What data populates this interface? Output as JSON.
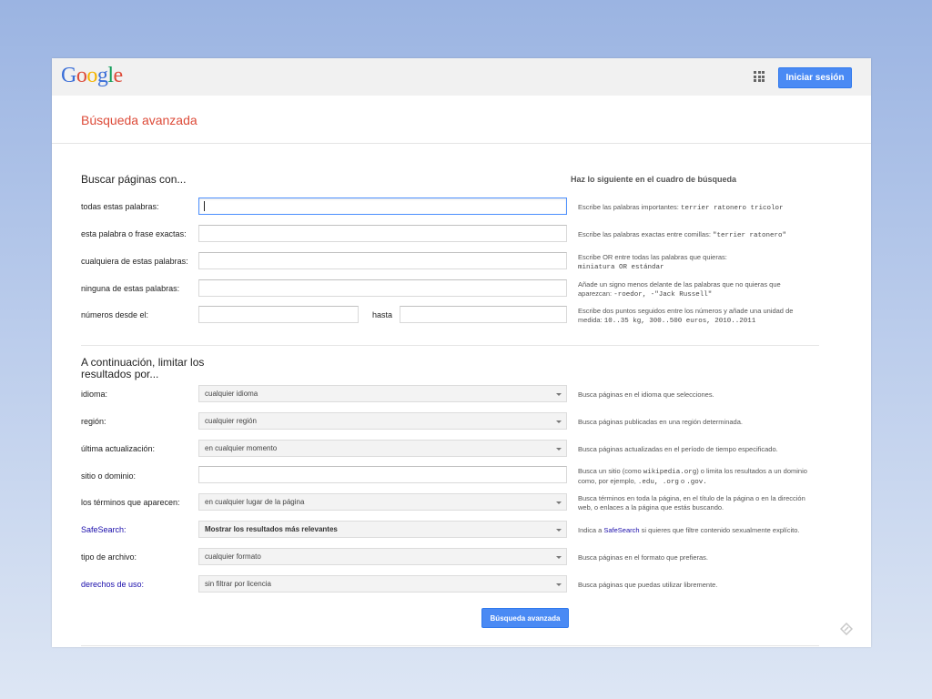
{
  "header": {
    "logo": {
      "letters": [
        "G",
        "o",
        "o",
        "g",
        "l",
        "e"
      ],
      "colors": [
        "#3b6fd8",
        "#dd4b39",
        "#f4b400",
        "#3b6fd8",
        "#0f9d58",
        "#dd4b39"
      ]
    },
    "apps_icon": "apps-grid-icon",
    "signin_label": "Iniciar sesión"
  },
  "page_title": "Búsqueda avanzada",
  "section1": {
    "title": "Buscar páginas con...",
    "hint_title": "Haz lo siguiente en el cuadro de búsqueda",
    "rows": [
      {
        "label": "todas estas palabras:",
        "value": "",
        "hint_text": "Escribe las palabras importantes: ",
        "hint_mono": "terrier ratonero tricolor"
      },
      {
        "label": "esta palabra o frase exactas:",
        "value": "",
        "hint_text": "Escribe las palabras exactas entre comillas: ",
        "hint_mono": "\"terrier ratonero\""
      },
      {
        "label": "cualquiera de estas palabras:",
        "value": "",
        "hint_text": "Escribe OR entre todas las palabras que quieras:",
        "hint_mono": "miniatura OR estándar"
      },
      {
        "label": "ninguna de estas palabras:",
        "value": "",
        "hint_text": "Añade un signo menos delante de las palabras que no quieras que aparezcan: ",
        "hint_mono": "-roedor, -\"Jack Russell\""
      },
      {
        "label": "números desde el:",
        "value": "",
        "hasta_label": "hasta",
        "hasta_value": "",
        "hint_text": "Escribe dos puntos seguidos entre los números y añade una unidad de medida: ",
        "hint_mono": "10..35 kg, 300..500 euros, 2010..2011"
      }
    ]
  },
  "section2": {
    "title_line1": "A continuación, limitar los",
    "title_line2": "resultados por...",
    "rows": [
      {
        "label": "idioma:",
        "value": "cualquier idioma",
        "hint": "Busca páginas en el idioma que selecciones."
      },
      {
        "label": "región:",
        "value": "cualquier región",
        "hint": "Busca páginas publicadas en una región determinada."
      },
      {
        "label": "última actualización:",
        "value": "en cualquier momento",
        "hint": "Busca páginas actualizadas en el período de tiempo especificado."
      },
      {
        "label": "sitio o dominio:",
        "value": "",
        "hint_a": "Busca un sitio (como ",
        "hint_mono_a": "wikipedia.org",
        "hint_b": ") o limita los resultados a un dominio como, por ejemplo, ",
        "hint_mono_b": ".edu, .org",
        "hint_c": " o ",
        "hint_mono_c": ".gov."
      },
      {
        "label": "los términos que aparecen:",
        "value": "en cualquier lugar de la página",
        "hint": "Busca términos en toda la página, en el título de la página o en la dirección web, o enlaces a la página que estás buscando."
      },
      {
        "label": "SafeSearch:",
        "value": "Mostrar los resultados más relevantes",
        "hint_a": "Indica a ",
        "hint_link": "SafeSearch",
        "hint_b": " si quieres que filtre contenido sexualmente explícito."
      },
      {
        "label": "tipo de archivo:",
        "value": "cualquier formato",
        "hint": "Busca páginas en el formato que prefieras."
      },
      {
        "label": "derechos de uso:",
        "value": "sin filtrar por licencia",
        "hint": "Busca páginas que puedas utilizar libremente."
      }
    ]
  },
  "submit_label": "Búsqueda avanzada",
  "feedback_icon": "feedback-icon"
}
